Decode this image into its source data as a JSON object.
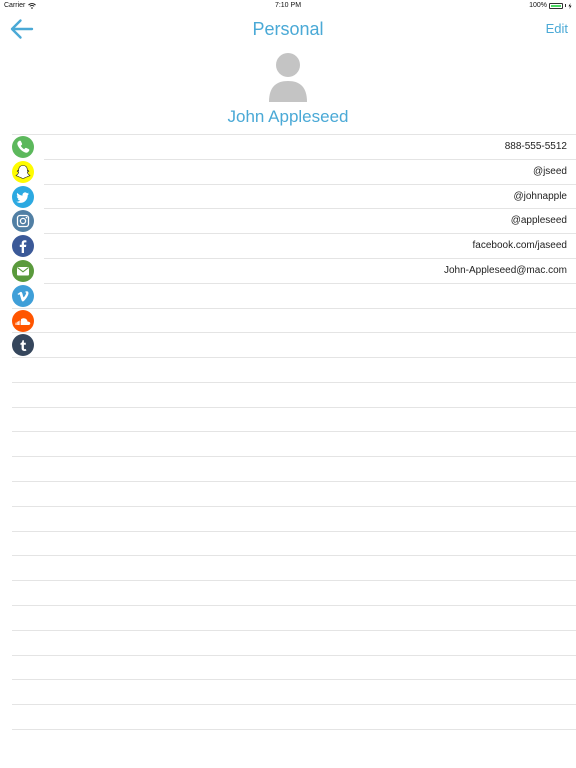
{
  "status_bar": {
    "carrier": "Carrier",
    "time": "7:10 PM",
    "battery": "100%",
    "battery_level": 1.0,
    "icons": [
      "wifi-icon",
      "battery-icon",
      "charging-icon"
    ]
  },
  "nav": {
    "title": "Personal",
    "edit_label": "Edit",
    "back_icon": "back-arrow-icon"
  },
  "contact": {
    "name": "John Appleseed",
    "avatar_icon": "person-silhouette-icon"
  },
  "colors": {
    "accent": "#4aa9d6",
    "phone": "#5cb85c",
    "snapchat": "#fffc00",
    "twitter": "#2ca9e1",
    "instagram": "#517fa4",
    "facebook": "#3b5998",
    "email": "#5a9a3c",
    "vimeo": "#3f9fd8",
    "soundcloud": "#ff5500",
    "tumblr": "#35465c"
  },
  "fields": [
    {
      "service": "phone",
      "icon": "phone-icon",
      "value": "888-555-5512"
    },
    {
      "service": "snapchat",
      "icon": "snapchat-icon",
      "value": "@jseed"
    },
    {
      "service": "twitter",
      "icon": "twitter-icon",
      "value": "@johnapple"
    },
    {
      "service": "instagram",
      "icon": "instagram-icon",
      "value": "@appleseed"
    },
    {
      "service": "facebook",
      "icon": "facebook-icon",
      "value": "facebook.com/jaseed"
    },
    {
      "service": "email",
      "icon": "email-icon",
      "value": "John-Appleseed@mac.com"
    },
    {
      "service": "vimeo",
      "icon": "vimeo-icon",
      "value": ""
    },
    {
      "service": "soundcloud",
      "icon": "soundcloud-icon",
      "value": ""
    },
    {
      "service": "tumblr",
      "icon": "tumblr-icon",
      "value": ""
    }
  ]
}
